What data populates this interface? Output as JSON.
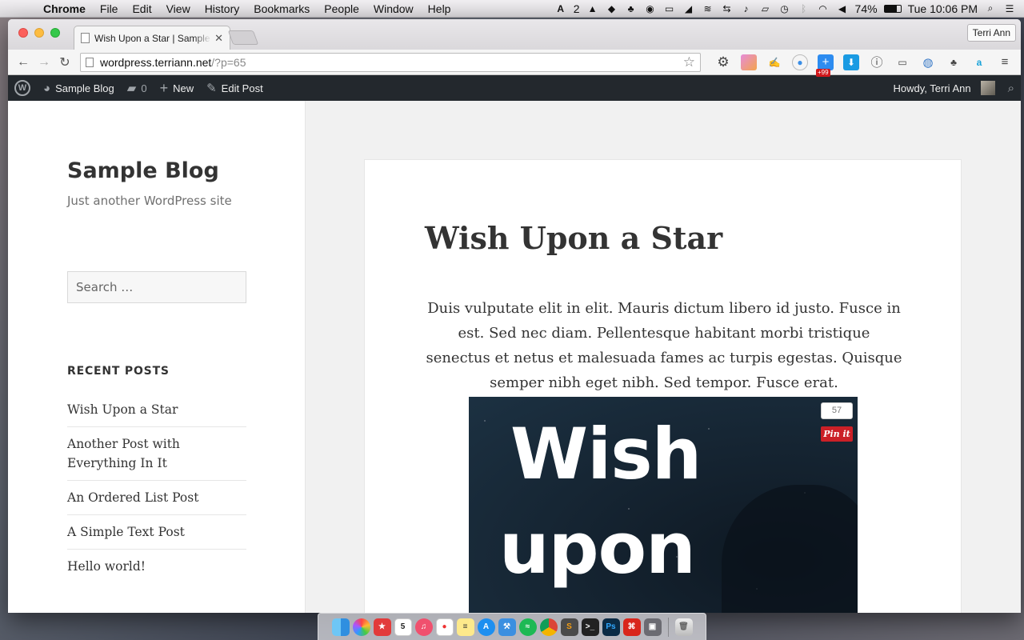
{
  "menubar": {
    "app_name": "Chrome",
    "menus": [
      "File",
      "Edit",
      "View",
      "History",
      "Bookmarks",
      "People",
      "Window",
      "Help"
    ],
    "adobe_count": "2",
    "battery": "74%",
    "clock": "Tue 10:06 PM"
  },
  "browser": {
    "tab_title": "Wish Upon a Star | Sample",
    "profile_name": "Terri Ann",
    "url_host": "wordpress.terriann.net",
    "url_path": "/?p=65",
    "extension_badge": "+99"
  },
  "adminbar": {
    "site_name": "Sample Blog",
    "comments_count": "0",
    "new_label": "New",
    "edit_label": "Edit Post",
    "howdy": "Howdy, Terri Ann"
  },
  "sidebar": {
    "site_title": "Sample Blog",
    "tagline": "Just another WordPress site",
    "search_placeholder": "Search …",
    "recent_posts_heading": "RECENT POSTS",
    "recent_posts": [
      "Wish Upon a Star",
      "Another Post with Everything In It",
      "An Ordered List Post",
      "A Simple Text Post",
      "Hello world!"
    ]
  },
  "post": {
    "title": "Wish Upon a Star",
    "body": "Duis vulputate elit in elit. Mauris dictum libero id justo. Fusce in est. Sed nec diam. Pellentesque habitant morbi tristique senectus et netus et malesuada fames ac turpis egestas. Quisque semper nibh eget nibh. Sed tempor. Fusce erat.",
    "image_text_line1": "Wish",
    "image_text_line2": "upon",
    "pin_count": "57",
    "pin_label": "Pin it"
  },
  "dock": {
    "calendar_day": "5",
    "photoshop_label": "Ps"
  },
  "colors": {
    "admin_bar": "#23282d",
    "pin_red": "#cb2027"
  }
}
